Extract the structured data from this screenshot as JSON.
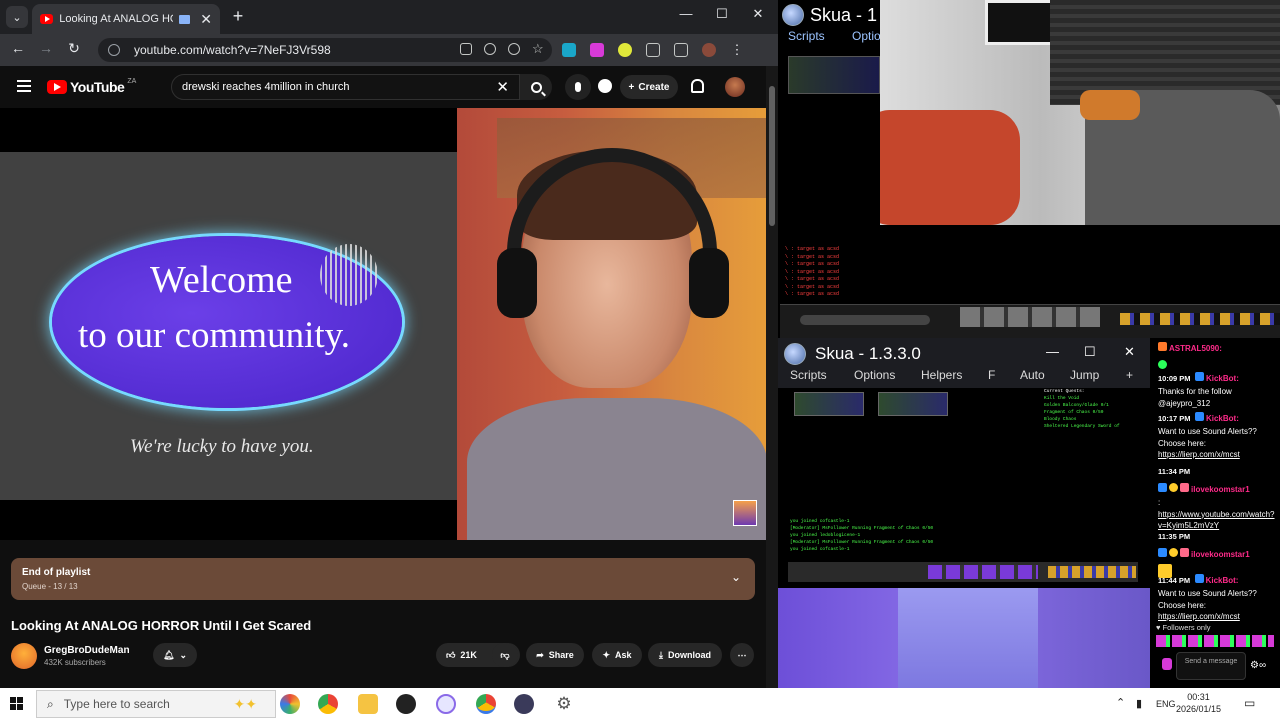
{
  "browser": {
    "tab_title": "Looking At ANALOG HORRO",
    "url": "youtube.com/watch?v=7NeFJ3Vr598"
  },
  "youtube": {
    "country_code": "ZA",
    "logo_text": "YouTube",
    "search_query": "drewski reaches 4million in church",
    "create_label": "Create",
    "video_slide": {
      "line1": "Welcome",
      "line2": "to our community.",
      "line3": "We're lucky to have you."
    },
    "playlist": {
      "title": "End of playlist",
      "subtitle": "Queue - 13 / 13"
    },
    "video_title": "Looking At ANALOG HORROR Until I Get Scared",
    "channel_name": "GregBroDudeMan",
    "subscribers": "432K subscribers",
    "like_count": "21K",
    "share_label": "Share",
    "ask_label": "Ask",
    "download_label": "Download"
  },
  "skua": {
    "title1": "Skua - 1",
    "menu1": [
      "Scripts",
      "Optio"
    ],
    "title2": "Skua - 1.3.3.0",
    "menu2": [
      "Scripts",
      "Options",
      "Helpers",
      "F",
      "Auto",
      "Jump",
      "+"
    ]
  },
  "chat": {
    "messages": [
      {
        "time": "",
        "user": "ASTRAL5090:",
        "text": ""
      },
      {
        "time": "10:09 PM",
        "user": "KickBot:",
        "text": "Thanks for the follow @ajeypro_312"
      },
      {
        "time": "10:17 PM",
        "user": "KickBot:",
        "text": "Want to use Sound Alerts?? Choose here:",
        "link": "https://lierp.com/x/mcst"
      },
      {
        "time": "11:34 PM",
        "user": "ilovekoomstar1",
        "text": ":",
        "link": "https://www.youtube.com/watch?v=Kyim5L2mVzY"
      },
      {
        "time": "11:35 PM",
        "user": "ilovekoomstar1",
        "text": ""
      },
      {
        "time": "11:44 PM",
        "user": "KickBot:",
        "text": "Want to use Sound Alerts?? Choose here:",
        "link": "https://lierp.com/x/mcst"
      }
    ],
    "followers_only": "Followers only",
    "send_placeholder": "Send a message"
  },
  "taskbar": {
    "search_placeholder": "Type here to search",
    "lang": "ENG",
    "time": "00:31",
    "date": "2026/01/15"
  },
  "colors": {
    "yt_red": "#ff0000",
    "chat_user_pink": "#ff2b8a",
    "chat_user_yellow": "#d9ff2b",
    "playlist_bg": "#6b4a38"
  }
}
